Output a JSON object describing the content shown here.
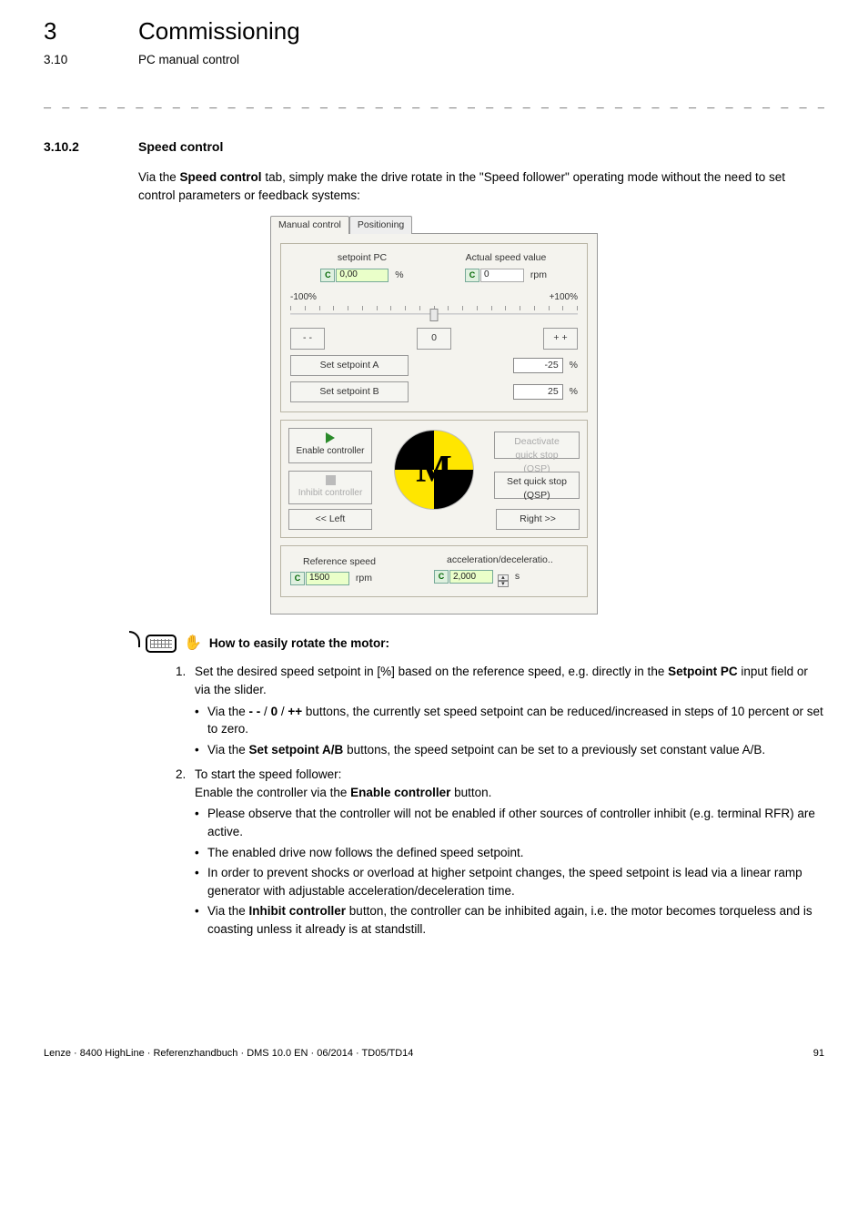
{
  "chapter": {
    "num": "3",
    "title": "Commissioning"
  },
  "subchapter": {
    "num": "3.10",
    "title": "PC manual control"
  },
  "section": {
    "num": "3.10.2",
    "title": "Speed control"
  },
  "intro_pre": "Via the ",
  "intro_bold": "Speed control",
  "intro_post": " tab, simply make the drive rotate in the \"Speed follower\" operating mode without the need to set control parameters or feedback systems:",
  "dialog": {
    "tabs": {
      "t1": "Manual control",
      "t2": "Positioning"
    },
    "setpoint_label": "setpoint PC",
    "setpoint_val": "0,00",
    "setpoint_unit": "%",
    "actual_label": "Actual speed value",
    "actual_val": "0",
    "actual_unit": "rpm",
    "minus100": "-100%",
    "plus100": "+100%",
    "btn_mm": "- -",
    "btn_0": "0",
    "btn_pp": "+ +",
    "spA_btn": "Set setpoint A",
    "spA_val": "-25",
    "spB_btn": "Set setpoint B",
    "spB_val": "25",
    "pct": "%",
    "enable": "Enable controller",
    "inhibit": "Inhibit controller",
    "deact_qsp": "Deactivate quick stop (QSP)",
    "set_qsp": "Set quick stop (QSP)",
    "left": "<<  Left",
    "right": "Right >>",
    "ref_label": "Reference speed",
    "ref_val": "1500",
    "ref_unit": "rpm",
    "accel_label": "acceleration/deceleratio..",
    "accel_val": "2,000",
    "accel_unit": "s"
  },
  "howto_title": "How to easily rotate the motor:",
  "steps": {
    "s1_a": "Set the desired speed setpoint in [%] based on the reference speed, e.g. directly in the ",
    "s1_b": "Setpoint PC",
    "s1_c": " input field or via the slider.",
    "s1_1_a": "Via the ",
    "s1_1_b": "- -",
    "s1_1_c": " / ",
    "s1_1_d": "0",
    "s1_1_e": " / ",
    "s1_1_f": "++",
    "s1_1_g": " buttons, the currently set speed setpoint can be reduced/increased in steps of 10 percent or set to zero.",
    "s1_2_a": "Via the ",
    "s1_2_b": "Set setpoint A/B",
    "s1_2_c": " buttons, the speed setpoint can be set to a previously set constant value A/B.",
    "s2_a": "To start the speed follower:",
    "s2_b1": "Enable the controller via the ",
    "s2_b2": "Enable controller",
    "s2_b3": " button.",
    "s2_1": "Please observe that the controller will not be enabled if other sources of controller inhibit (e.g. terminal RFR) are active.",
    "s2_2": "The enabled drive now follows the defined speed setpoint.",
    "s2_3": "In order to prevent shocks or overload at higher setpoint changes, the speed setpoint is lead via a linear ramp generator with adjustable acceleration/deceleration time.",
    "s2_4_a": "Via the ",
    "s2_4_b": "Inhibit controller",
    "s2_4_c": " button, the controller can be inhibited again, i.e. the motor becomes torqueless and is coasting unless it already is at standstill."
  },
  "footer": {
    "left": "Lenze · 8400 HighLine · Referenzhandbuch · DMS 10.0 EN · 06/2014 · TD05/TD14",
    "right": "91"
  }
}
